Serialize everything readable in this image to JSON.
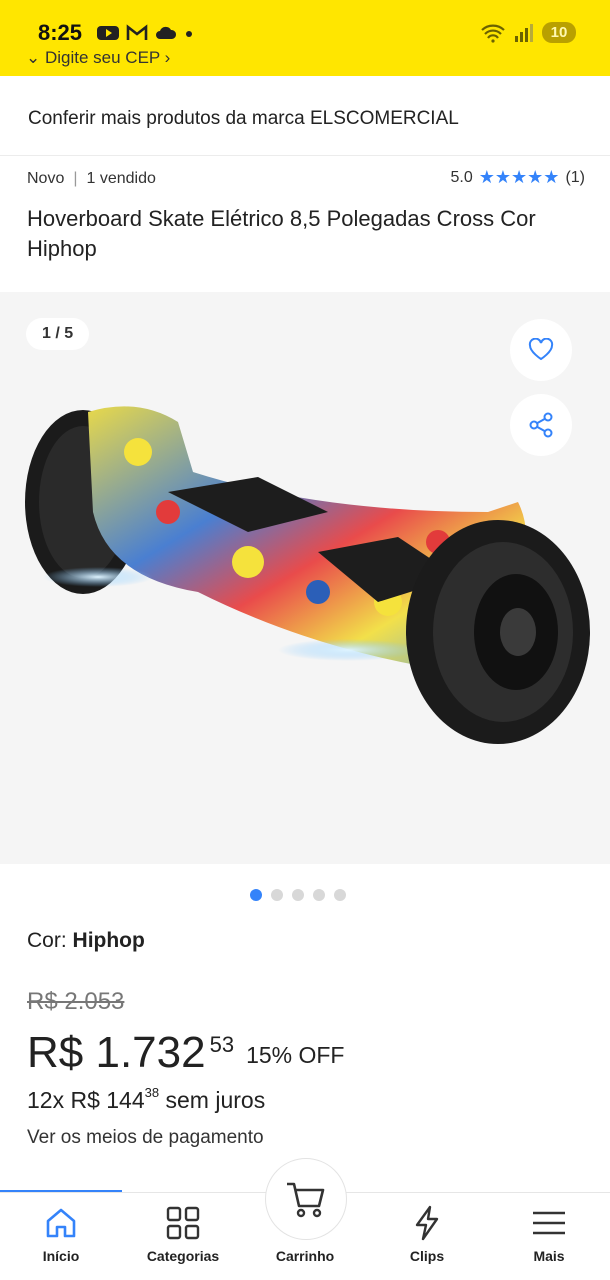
{
  "status_bar": {
    "time": "8:25",
    "battery": "10",
    "icons": [
      "youtube-icon",
      "gmail-icon",
      "cloud-icon",
      "notification-dot-icon",
      "wifi-icon",
      "signal-icon"
    ]
  },
  "search": {
    "cep_peek": "Digite seu CEP"
  },
  "brand": {
    "link_text": "Conferir mais produtos da marca ELSCOMERCIAL"
  },
  "product": {
    "condition": "Novo",
    "sold": "1 vendido",
    "rating_value": "5.0",
    "rating_count": "(1)",
    "stars": "★★★★★",
    "title": "Hoverboard Skate Elétrico 8,5 Polegadas Cross Cor Hiphop"
  },
  "gallery": {
    "counter": "1 / 5",
    "total_images": 5,
    "active_index": 0
  },
  "variant": {
    "label": "Cor:",
    "value": "Hiphop"
  },
  "pricing": {
    "original_price": "R$ 2.053",
    "price_main": "R$ 1.732",
    "price_cents": "53",
    "discount": "15% OFF",
    "installment_prefix": "12x R$ 144",
    "installment_cents": "38",
    "installment_suffix": "sem juros",
    "payment_link": "Ver os meios de pagamento"
  },
  "bottom_nav": {
    "items": [
      {
        "label": "Início",
        "icon": "home-icon",
        "active": true
      },
      {
        "label": "Categorias",
        "icon": "grid-icon",
        "active": false
      },
      {
        "label": "Carrinho",
        "icon": "cart-icon",
        "active": false
      },
      {
        "label": "Clips",
        "icon": "lightning-icon",
        "active": false
      },
      {
        "label": "Mais",
        "icon": "menu-icon",
        "active": false
      }
    ]
  },
  "colors": {
    "header_yellow": "#ffe600",
    "accent_blue": "#3483fa",
    "gallery_bg": "#f5f5f5"
  }
}
